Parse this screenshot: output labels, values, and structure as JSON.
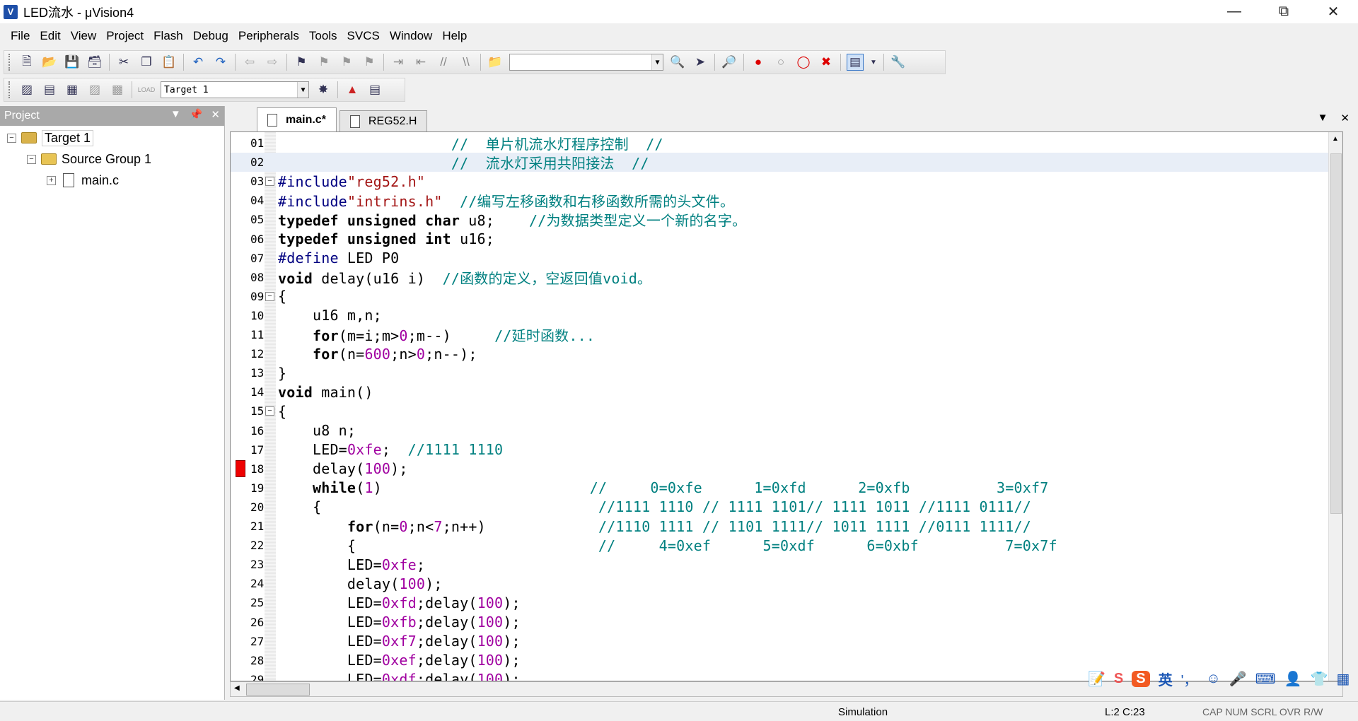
{
  "window": {
    "title": "LED流水 - μVision4",
    "app_icon": "V"
  },
  "menu": [
    "File",
    "Edit",
    "View",
    "Project",
    "Flash",
    "Debug",
    "Peripherals",
    "Tools",
    "SVCS",
    "Window",
    "Help"
  ],
  "toolbar": {
    "target_combo": "Target 1"
  },
  "project": {
    "header": "Project",
    "tree": [
      {
        "label": "Target 1",
        "level": 0
      },
      {
        "label": "Source Group 1",
        "level": 1
      },
      {
        "label": "main.c",
        "level": 2
      }
    ]
  },
  "tabs": [
    {
      "label": "main.c*",
      "active": true
    },
    {
      "label": "REG52.H",
      "active": false
    }
  ],
  "editor": {
    "current_line": 2,
    "breakpoint_line": 18,
    "lines": [
      {
        "n": "01",
        "html": "                    <span class='cm'>//  单片机流水灯程序控制  //</span>"
      },
      {
        "n": "02",
        "html": "                    <span class='cm'>//  流水灯采用共阳接法  //</span>"
      },
      {
        "n": "03",
        "fold": "-",
        "html": "<span class='dir'>#include</span><span class='str'>\"reg52.h\"</span>"
      },
      {
        "n": "04",
        "html": "<span class='dir'>#include</span><span class='str'>\"intrins.h\"</span>  <span class='cm'>//编写左移函数和右移函数所需的头文件。</span>"
      },
      {
        "n": "05",
        "html": "<span class='tp'>typedef unsigned char</span> u8;    <span class='cm'>//为数据类型定义一个新的名字。</span>"
      },
      {
        "n": "06",
        "html": "<span class='tp'>typedef unsigned int</span> u16;"
      },
      {
        "n": "07",
        "html": "<span class='dir'>#define</span> LED P0"
      },
      {
        "n": "08",
        "html": "<span class='tp'>void</span> delay(u16 i)  <span class='cm'>//函数的定义，空返回值void。</span>"
      },
      {
        "n": "09",
        "fold": "-",
        "html": "{"
      },
      {
        "n": "10",
        "html": "    u16 m,n;"
      },
      {
        "n": "11",
        "html": "    <span class='tp'>for</span>(m=i;m&gt;<span class='num'>0</span>;m--)     <span class='cm'>//延时函数...</span>"
      },
      {
        "n": "12",
        "html": "    <span class='tp'>for</span>(n=<span class='num'>600</span>;n&gt;<span class='num'>0</span>;n--);"
      },
      {
        "n": "13",
        "html": "}"
      },
      {
        "n": "14",
        "html": "<span class='tp'>void</span> main()"
      },
      {
        "n": "15",
        "fold": "-",
        "html": "{"
      },
      {
        "n": "16",
        "html": "    u8 n;"
      },
      {
        "n": "17",
        "html": "    LED=<span class='num'>0xfe</span>;  <span class='cm'>//1111 1110</span>"
      },
      {
        "n": "18",
        "html": "    delay(<span class='num'>100</span>);"
      },
      {
        "n": "19",
        "html": "    <span class='tp'>while</span>(<span class='num'>1</span>)                        <span class='cm'>//     0=0xfe      1=0xfd      2=0xfb          3=0xf7</span>"
      },
      {
        "n": "20",
        "html": "    {                                <span class='cm'>//1111 1110 // 1111 1101// 1111 1011 //1111 0111//</span>"
      },
      {
        "n": "21",
        "html": "        <span class='tp'>for</span>(n=<span class='num'>0</span>;n&lt;<span class='num'>7</span>;n++)             <span class='cm'>//1110 1111 // 1101 1111// 1011 1111 //0111 1111//</span>"
      },
      {
        "n": "22",
        "html": "        {                            <span class='cm'>//     4=0xef      5=0xdf      6=0xbf          7=0x7f</span>"
      },
      {
        "n": "23",
        "html": "        LED=<span class='num'>0xfe</span>;"
      },
      {
        "n": "24",
        "html": "        delay(<span class='num'>100</span>);"
      },
      {
        "n": "25",
        "html": "        LED=<span class='num'>0xfd</span>;delay(<span class='num'>100</span>);"
      },
      {
        "n": "26",
        "html": "        LED=<span class='num'>0xfb</span>;delay(<span class='num'>100</span>);"
      },
      {
        "n": "27",
        "html": "        LED=<span class='num'>0xf7</span>;delay(<span class='num'>100</span>);"
      },
      {
        "n": "28",
        "html": "        LED=<span class='num'>0xef</span>;delay(<span class='num'>100</span>);"
      },
      {
        "n": "29",
        "html": "        LED=<span class='num'>0xdf</span>;delay(<span class='num'>100</span>);"
      }
    ]
  },
  "status": {
    "mode": "Simulation",
    "position": "L:2 C:23",
    "indicators": "CAP  NUM  SCRL  OVR  R/W"
  },
  "ime": {
    "lang": "英",
    "punct": "'，"
  }
}
